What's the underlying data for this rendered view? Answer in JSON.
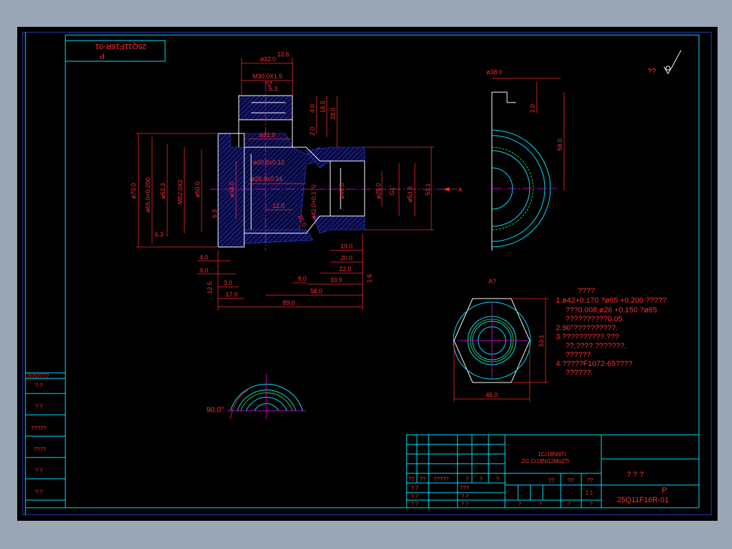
{
  "drawing": {
    "corner_label_top": "P",
    "corner_label_bottom": "25Q11F16R-01",
    "roughness_note": "??",
    "view_a_label": "A?",
    "arrow_label": "A"
  },
  "dimensions": {
    "d32": "ø32.0",
    "r12_6": "12.6",
    "m30": "M30.0X1.5",
    "r6_3a": "6.3",
    "d4": "4.0",
    "d16": "16.0",
    "d28": "28.0",
    "d31": "ø31.0",
    "d2": "2.0",
    "d20": "ø20.0±0.12",
    "d26": "ø26.0±0.14",
    "d12": "12.0",
    "d42": "ø42.0+0.170",
    "d46": "ø46.0",
    "d25": "ø25.0",
    "g1": "G1\"",
    "d53_3": "ø53.3",
    "d53_1": "53.1",
    "d70": "ø70.0",
    "d65": "ø65.0+0.200",
    "d52_3": "ø52.3",
    "m52": "M52.0X2",
    "d50": "ø50.0",
    "d34": "ø34.0",
    "d20r": "20.0",
    "l4": "4.0",
    "l9": "9.0",
    "l3": "3.0",
    "l17": "17.0",
    "l8": "8.0",
    "l19": "19.0",
    "l20": "20.0",
    "l22": "22.0",
    "l33": "33.0",
    "l58": "58.0",
    "l89": "89.0",
    "d38": "ø38.0",
    "d2_0": "2.0",
    "d58": "58.0",
    "d53_1b": "53.1",
    "d46b": "46.0",
    "angle90": "90.0°",
    "r6_3b": "6.3",
    "r6_3c": "6.3",
    "r12_5": "12.5",
    "r1_6": "1.6"
  },
  "notes": {
    "heading": "????",
    "lines": [
      "1.ø42+0.170 ?ø65 +0.200 ?????",
      "???0.008,ø26 +0.150 ?ø65",
      "??????????0.05.",
      "2.90°??????????.",
      "3.??????????.???",
      "??,????.???????,",
      "??????.",
      "4.?????F1072-65????",
      "??????."
    ]
  },
  "left_strip": {
    "header": "?(?)????",
    "rows": [
      "?   ?",
      "?   ?",
      "?????",
      "????",
      "?   ?",
      "?   ?"
    ]
  },
  "title_block": {
    "material_1": "1Cr18Ni9Ti",
    "material_2": "ZG  Cr18Ni12Mo2Ti",
    "title": "?  ?  ?",
    "code_letter": "P",
    "code": "25Q11F16R-01",
    "header_row": [
      "??",
      "??",
      "?????",
      "?",
      "?",
      "?"
    ],
    "sign_rows": [
      [
        "?  ?",
        "???"
      ],
      [
        "?  ?",
        "?  ?"
      ],
      [
        "?  ?",
        "?  ?"
      ],
      [
        "?  ?",
        "?  ?"
      ]
    ],
    "mid_labels": [
      "??",
      "??",
      "??"
    ],
    "scale": "1  1",
    "bottom_labels": [
      "?",
      "?",
      "?",
      "?"
    ]
  }
}
